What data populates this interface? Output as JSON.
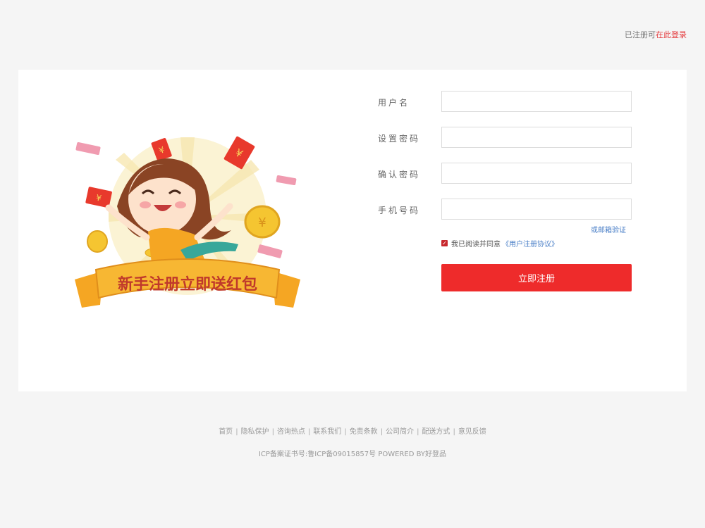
{
  "header": {
    "login_prompt": "已注册可",
    "login_link": "在此登录"
  },
  "banner": {
    "ribbon_text": "新手注册立即送红包"
  },
  "form": {
    "username_label": "用户名",
    "password_label": "设置密码",
    "confirm_label": "确认密码",
    "phone_label": "手机号码",
    "email_verify_link": "或邮箱验证",
    "agree_text": "我已阅读并同意",
    "agreement_link": "《用户注册协议》",
    "submit_label": "立即注册"
  },
  "footer": {
    "links": [
      "首页",
      "隐私保护",
      "咨询热点",
      "联系我们",
      "免责条款",
      "公司简介",
      "配送方式",
      "意见反馈"
    ],
    "icp": "ICP备案证书号:鲁ICP备09015857号 POWERED BY好登品"
  },
  "colors": {
    "accent": "#ee2b2b",
    "link": "#4a7fc7",
    "background": "#f5f5f5"
  }
}
